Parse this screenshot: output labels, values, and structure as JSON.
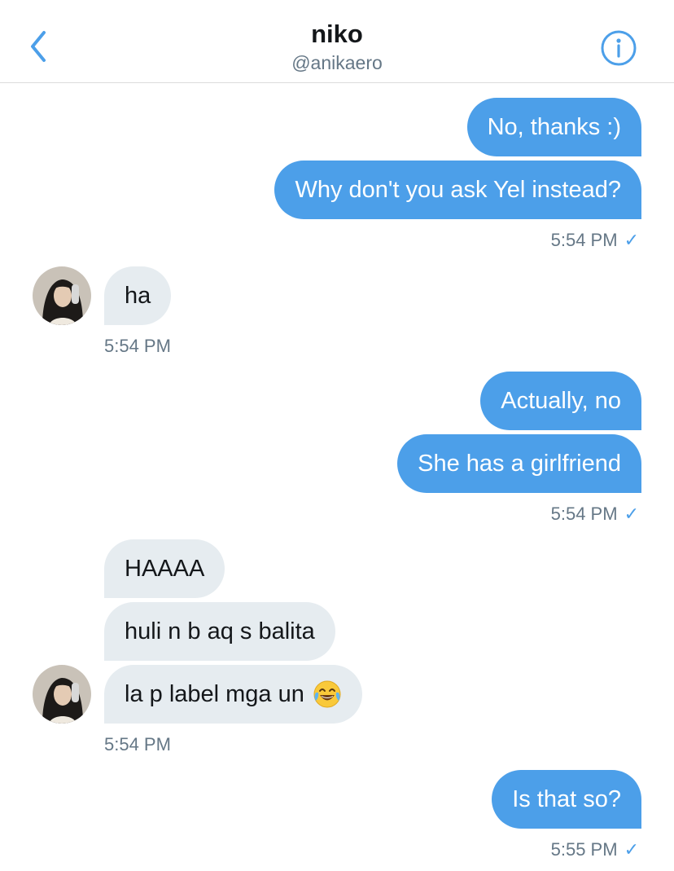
{
  "header": {
    "title": "niko",
    "handle": "@anikaero",
    "back_icon": "chevron-left-icon",
    "info_icon": "info-icon",
    "accent_color": "#4c9fe9"
  },
  "messages": [
    {
      "direction": "outgoing",
      "text": "No, thanks :)"
    },
    {
      "direction": "outgoing",
      "text": "Why don't you ask Yel instead?"
    },
    {
      "direction": "outgoing",
      "text": "Actually, no"
    },
    {
      "direction": "outgoing",
      "text": "She has a girlfriend"
    },
    {
      "direction": "incoming",
      "text": "ha"
    },
    {
      "direction": "incoming",
      "text": "HAAAA"
    },
    {
      "direction": "incoming",
      "text": "huli n b aq s balita"
    },
    {
      "direction": "incoming",
      "text": "la p label mga un",
      "emoji": "face-with-tears-of-joy"
    },
    {
      "direction": "outgoing",
      "text": "Is that so?"
    }
  ],
  "timestamps": {
    "t1": "5:54 PM",
    "t2": "5:54 PM",
    "t3": "5:54 PM",
    "t4": "5:54 PM",
    "t5": "5:55 PM"
  },
  "read_check": "✓",
  "colors": {
    "outgoing_bubble": "#4c9fe9",
    "incoming_bubble": "#e6ecf0",
    "timestamp_text": "#657786"
  }
}
